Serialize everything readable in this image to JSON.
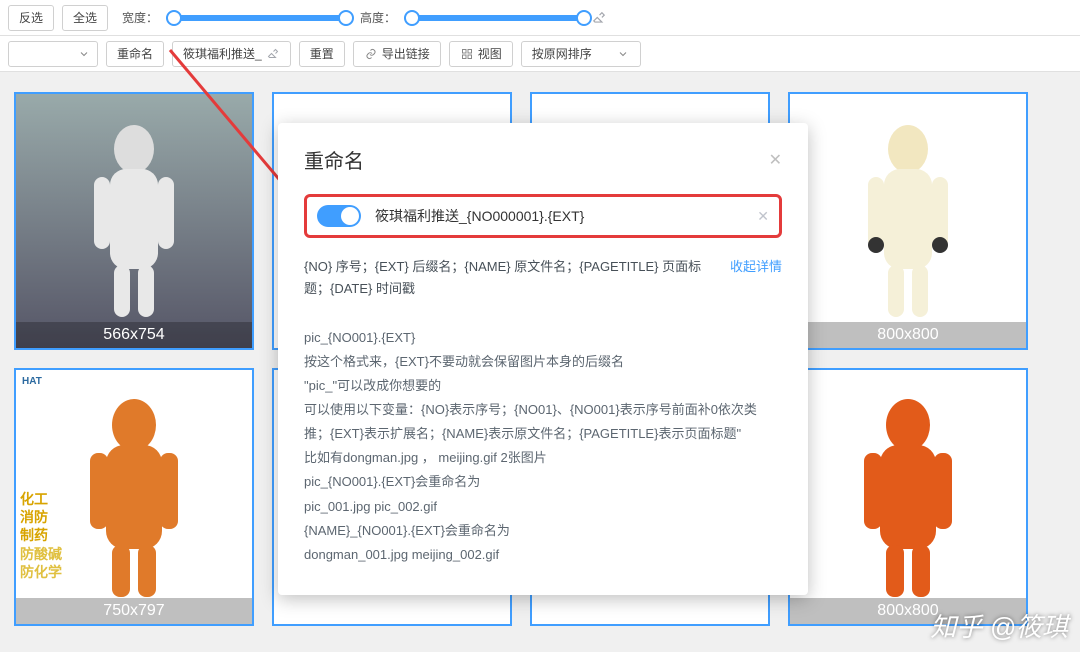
{
  "toolbar1": {
    "invert_select": "反选",
    "select_all": "全选",
    "width_label": "宽度：",
    "height_label": "高度："
  },
  "toolbar2": {
    "rename": "重命名",
    "push_preset": "筱琪福利推送_",
    "reset": "重置",
    "export_links": "导出链接",
    "view": "视图",
    "sort_by_source": "按原网排序"
  },
  "grid": {
    "cards": [
      {
        "dim": "566x754"
      },
      {
        "dim": ""
      },
      {
        "dim": ""
      },
      {
        "dim": "800x800"
      },
      {
        "dim": "750x797"
      },
      {
        "dim": ""
      },
      {
        "dim": ""
      },
      {
        "dim": "800x800"
      }
    ]
  },
  "modal": {
    "title": "重命名",
    "input_value": "筱琪福利推送_{NO000001}.{EXT}",
    "hint": "{NO} 序号；{EXT} 后缀名；{NAME} 原文件名；{PAGETITLE} 页面标题；{DATE} 时间戳",
    "collapse": "收起详情",
    "details": "pic_{NO001}.{EXT}\n按这个格式来，{EXT}不要动就会保留图片本身的后缀名\n\"pic_\"可以改成你想要的\n可以使用以下变量：{NO}表示序号；{NO01}、{NO001}表示序号前面补0依次类推；{EXT}表示扩展名；{NAME}表示原文件名；{PAGETITLE}表示页面标题\"\n比如有dongman.jpg ，  meijing.gif 2张图片\npic_{NO001}.{EXT}会重命名为\npic_001.jpg pic_002.gif\n{NAME}_{NO001}.{EXT}会重命名为\ndongman_001.jpg meijing_002.gif"
  },
  "watermark": "知乎 @筱琪"
}
